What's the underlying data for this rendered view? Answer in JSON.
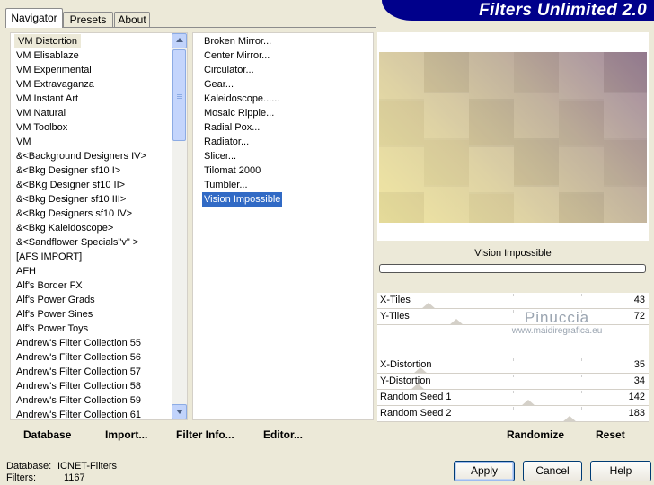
{
  "tabs": [
    "Navigator",
    "Presets",
    "About"
  ],
  "banner_title": "Filters Unlimited 2.0",
  "categories": [
    "VM Distortion",
    "VM Elisablaze",
    "VM Experimental",
    "VM Extravaganza",
    "VM Instant Art",
    "VM Natural",
    "VM Toolbox",
    "VM",
    "&<Background Designers IV>",
    "&<Bkg Designer sf10 I>",
    "&<BKg Designer sf10 II>",
    "&<Bkg Designer sf10 III>",
    "&<Bkg Designers sf10 IV>",
    "&<Bkg Kaleidoscope>",
    "&<Sandflower Specials\"v\" >",
    "[AFS IMPORT]",
    "AFH",
    "Alf's Border FX",
    "Alf's Power Grads",
    "Alf's Power Sines",
    "Alf's Power Toys",
    "Andrew's Filter Collection 55",
    "Andrew's Filter Collection 56",
    "Andrew's Filter Collection 57",
    "Andrew's Filter Collection 58",
    "Andrew's Filter Collection 59",
    "Andrew's Filter Collection 61"
  ],
  "filters": [
    "Broken Mirror...",
    "Center Mirror...",
    "Circulator...",
    "Gear...",
    "Kaleidoscope......",
    "Mosaic Ripple...",
    "Radial Pox...",
    "Radiator...",
    "Slicer...",
    "Tilomat 2000",
    "Tumbler...",
    "Vision Impossible"
  ],
  "selected_filter": "Vision Impossible",
  "params": [
    {
      "label": "X-Tiles",
      "value": "43",
      "level": 0.17
    },
    {
      "label": "Y-Tiles",
      "value": "72",
      "level": 0.28
    },
    {
      "label": "X-Distortion",
      "value": "35",
      "level": 0.14
    },
    {
      "label": "Y-Distortion",
      "value": "34",
      "level": 0.13
    },
    {
      "label": "Random Seed 1",
      "value": "142",
      "level": 0.56
    },
    {
      "label": "Random Seed 2",
      "value": "183",
      "level": 0.72
    }
  ],
  "watermark": {
    "line1": "Pinuccia",
    "line2": "www.maidiregrafica.eu"
  },
  "commands_left": [
    "Database",
    "Import...",
    "Filter Info...",
    "Editor..."
  ],
  "commands_right": [
    "Randomize",
    "Reset"
  ],
  "info": {
    "database_label": "Database:",
    "database_value": "ICNET-Filters",
    "filters_label": "Filters:",
    "filters_value": "1167"
  },
  "buttons": {
    "apply": "Apply",
    "cancel": "Cancel",
    "help": "Help"
  }
}
